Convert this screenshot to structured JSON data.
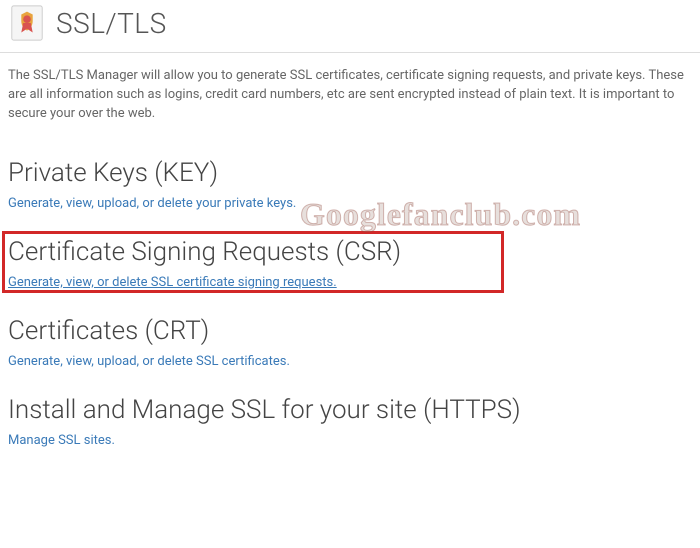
{
  "header": {
    "title": "SSL/TLS"
  },
  "intro": "The SSL/TLS Manager will allow you to generate SSL certificates, certificate signing requests, and private keys. These are all information such as logins, credit card numbers, etc are sent encrypted instead of plain text. It is important to secure your over the web.",
  "sections": {
    "key": {
      "heading": "Private Keys (KEY)",
      "link": "Generate, view, upload, or delete your private keys."
    },
    "csr": {
      "heading": "Certificate Signing Requests (CSR)",
      "link": "Generate, view, or delete SSL certificate signing requests."
    },
    "crt": {
      "heading": "Certificates (CRT)",
      "link": "Generate, view, upload, or delete SSL certificates."
    },
    "install": {
      "heading": "Install and Manage SSL for your site (HTTPS)",
      "link": "Manage SSL sites."
    }
  },
  "watermark": "Googlefanclub.com"
}
